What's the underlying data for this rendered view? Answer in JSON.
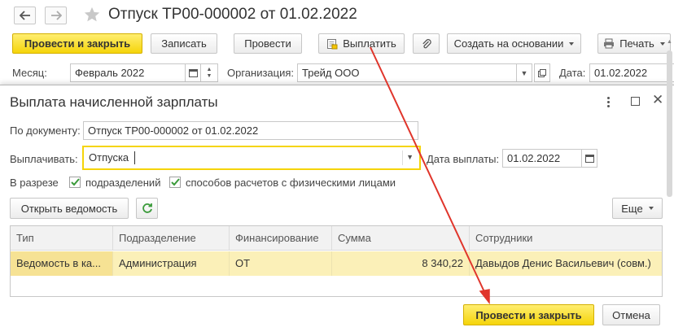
{
  "document": {
    "title": "Отпуск ТР00-000002 от 01.02.2022",
    "toolbar": {
      "post_close": "Провести и закрыть",
      "write": "Записать",
      "post": "Провести",
      "pay": "Выплатить",
      "create_basis": "Создать на основании",
      "print": "Печать"
    },
    "month_label": "Месяц:",
    "month_value": "Февраль 2022",
    "org_label": "Организация:",
    "org_value": "Трейд ООО",
    "date_label": "Дата:",
    "date_value": "01.02.2022"
  },
  "dialog": {
    "title": "Выплата начисленной зарплаты",
    "by_doc_label": "По документу:",
    "by_doc_value": "Отпуск ТР00-000002 от 01.02.2022",
    "pay_label": "Выплачивать:",
    "pay_value": "Отпуска",
    "pay_date_label": "Дата выплаты:",
    "pay_date_value": "01.02.2022",
    "breakdown_label": "В разрезе",
    "check_departments": "подразделений",
    "check_methods": "способов расчетов с физическими лицами",
    "open_statement": "Открыть ведомость",
    "more": "Еще",
    "table": {
      "columns": [
        "Тип",
        "Подразделение",
        "Финансирование",
        "Сумма",
        "Сотрудники"
      ],
      "rows": [
        [
          "Ведомость в ка...",
          "Администрация",
          "ОТ",
          "8 340,22",
          "Давыдов Денис Васильевич (совм.)"
        ]
      ]
    },
    "post_close": "Провести и закрыть",
    "cancel": "Отмена"
  },
  "colors": {
    "accent_yellow": "#f5d40a",
    "row_highlight": "#fbf0b8",
    "arrow_red": "#e0352b",
    "refresh_green": "#3a9a3a"
  }
}
